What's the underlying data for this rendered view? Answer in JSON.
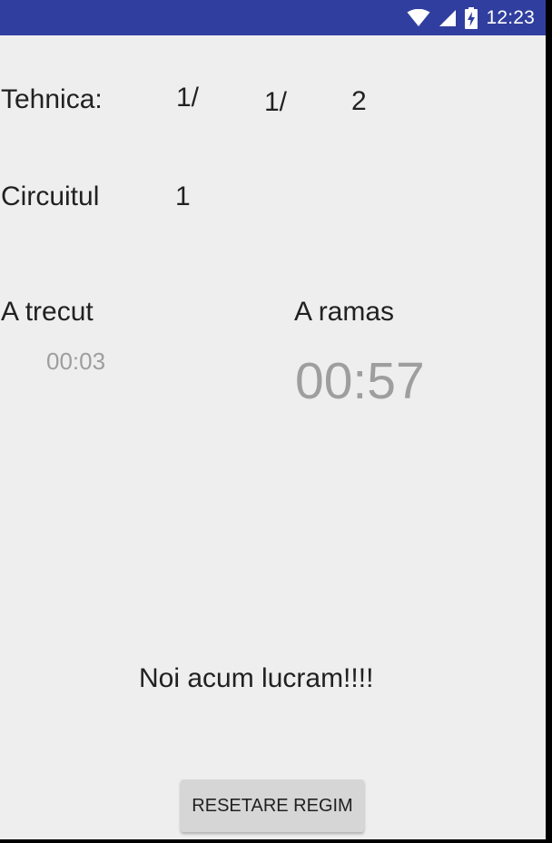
{
  "status_bar": {
    "time": "12:23",
    "icons": [
      "wifi-icon",
      "cell-signal-icon",
      "battery-charging-icon"
    ],
    "color": "#303f9f"
  },
  "technique": {
    "label": "Tehnica:",
    "part1": "1/",
    "part2": "1/",
    "part3": "2"
  },
  "circuit": {
    "label": "Circuitul",
    "value": "1"
  },
  "elapsed": {
    "label": "A trecut",
    "value": "00:03"
  },
  "remaining": {
    "label": "A ramas",
    "value": "00:57"
  },
  "status_message": "Noi acum lucram!!!!",
  "reset_button": {
    "label": "RESETARE REGIM"
  },
  "colors": {
    "background": "#eeeeee",
    "text": "#212121",
    "timer_text": "#9e9e9e",
    "button": "#d6d6d6"
  }
}
